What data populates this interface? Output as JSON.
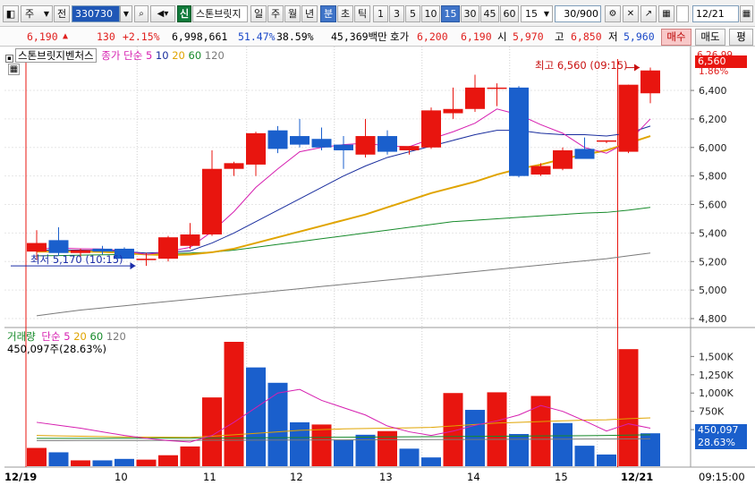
{
  "toolbar": {
    "type_label": "주",
    "prev_label": "전",
    "code": "330730",
    "market_badge": "신",
    "stock_name": "스톤브릿지",
    "periods": [
      "일",
      "주",
      "월",
      "년",
      "분",
      "초",
      "틱"
    ],
    "active_period": "분",
    "intervals": [
      "1",
      "3",
      "5",
      "10",
      "15",
      "30",
      "45",
      "60"
    ],
    "active_interval": "15",
    "interval_select": "15",
    "count_value": "30",
    "count_total": "/900",
    "date_value": "12/21"
  },
  "quote": {
    "price": "6,190",
    "change": "130",
    "change_pct": "+2.15%",
    "volume": "6,998,661",
    "vol_ratio": "51.47%",
    "turnover": "38.59%",
    "amount": "45,369백만",
    "ask_label": "호가",
    "ask_value": "6,200",
    "bid_value": "6,190",
    "open_label": "시",
    "open_value": "5,970",
    "high_label": "고",
    "high_value": "6,850",
    "low_label": "저",
    "low_value": "5,960",
    "buy_label": "매수",
    "sell_label": "매도",
    "extra_label": "평"
  },
  "price_panel": {
    "title": "스톤브릿지벤처스",
    "ma_label": "종가 단순",
    "ma_periods": [
      "5",
      "10",
      "20",
      "60",
      "120"
    ],
    "high_annotation": "최고 6,560 (09:15)",
    "low_annotation": "최저 5,170 (10:15)",
    "top_axis_label": "6,26.99",
    "current_price_tag": "6,560",
    "current_pct_tag": "1.86%"
  },
  "volume_panel": {
    "title": "거래량",
    "ma_label": "단순",
    "ma_periods": [
      "5",
      "20",
      "60",
      "120"
    ],
    "current_value_label": "450,097주(28.63%)",
    "value_tag": "450,097",
    "pct_tag": "28.63%"
  },
  "x_axis": {
    "labels": [
      "12/19",
      "10",
      "11",
      "12",
      "13",
      "14",
      "15",
      "12/21"
    ],
    "time_label": "09:15:00"
  },
  "colors": {
    "up": "#e8150f",
    "down": "#1a5fcc",
    "ma5": "#d61fb0",
    "ma10": "#1a2e9e",
    "ma20": "#e0a400",
    "ma60": "#168a2a",
    "ma120": "#7a7a7a"
  },
  "chart_data": {
    "type": "candlestick",
    "price": {
      "ylim": [
        4750,
        6620
      ],
      "ticks": [
        4800,
        5000,
        5200,
        5400,
        5600,
        5800,
        6000,
        6200,
        6400
      ],
      "tick_labels": [
        "4,800",
        "5,000",
        "5,200",
        "5,400",
        "5,600",
        "5,800",
        "6,000",
        "6,200",
        "6,400"
      ],
      "candles": [
        {
          "o": 5270,
          "h": 5420,
          "l": 5210,
          "c": 5330
        },
        {
          "o": 5350,
          "h": 5440,
          "l": 5240,
          "c": 5260
        },
        {
          "o": 5260,
          "h": 5290,
          "l": 5230,
          "c": 5280
        },
        {
          "o": 5290,
          "h": 5310,
          "l": 5250,
          "c": 5270
        },
        {
          "o": 5290,
          "h": 5300,
          "l": 5220,
          "c": 5220
        },
        {
          "o": 5210,
          "h": 5260,
          "l": 5170,
          "c": 5220
        },
        {
          "o": 5220,
          "h": 5380,
          "l": 5200,
          "c": 5370
        },
        {
          "o": 5310,
          "h": 5470,
          "l": 5290,
          "c": 5390
        },
        {
          "o": 5390,
          "h": 5980,
          "l": 5380,
          "c": 5850
        },
        {
          "o": 5850,
          "h": 5900,
          "l": 5800,
          "c": 5890
        },
        {
          "o": 5880,
          "h": 6110,
          "l": 5800,
          "c": 6100
        },
        {
          "o": 6120,
          "h": 6150,
          "l": 5960,
          "c": 5990
        },
        {
          "o": 6080,
          "h": 6200,
          "l": 6000,
          "c": 6020
        },
        {
          "o": 6060,
          "h": 6140,
          "l": 5980,
          "c": 6000
        },
        {
          "o": 6020,
          "h": 6080,
          "l": 5850,
          "c": 5980
        },
        {
          "o": 5950,
          "h": 6200,
          "l": 5930,
          "c": 6080
        },
        {
          "o": 6080,
          "h": 6120,
          "l": 5950,
          "c": 5970
        },
        {
          "o": 5980,
          "h": 6010,
          "l": 5950,
          "c": 6010
        },
        {
          "o": 6000,
          "h": 6280,
          "l": 5990,
          "c": 6260
        },
        {
          "o": 6240,
          "h": 6420,
          "l": 6200,
          "c": 6270
        },
        {
          "o": 6270,
          "h": 6510,
          "l": 6250,
          "c": 6420
        },
        {
          "o": 6420,
          "h": 6450,
          "l": 6290,
          "c": 6420
        },
        {
          "o": 6420,
          "h": 6430,
          "l": 5790,
          "c": 5800
        },
        {
          "o": 5810,
          "h": 5890,
          "l": 5800,
          "c": 5870
        },
        {
          "o": 5850,
          "h": 6000,
          "l": 5840,
          "c": 5980
        },
        {
          "o": 5990,
          "h": 6070,
          "l": 5920,
          "c": 5920
        },
        {
          "o": 6040,
          "h": 6050,
          "l": 6030,
          "c": 6050
        },
        {
          "o": 5970,
          "h": 6440,
          "l": 5960,
          "c": 6440
        },
        {
          "o": 6380,
          "h": 6560,
          "l": 6310,
          "c": 6540
        }
      ],
      "ma5": [
        5290,
        5295,
        5290,
        5288,
        5275,
        5250,
        5270,
        5300,
        5410,
        5550,
        5720,
        5850,
        5970,
        6000,
        6020,
        6030,
        6010,
        6005,
        6060,
        6110,
        6170,
        6270,
        6230,
        6160,
        6100,
        6000,
        5960,
        6040,
        6200
      ],
      "ma10": [
        5280,
        5280,
        5280,
        5278,
        5270,
        5260,
        5265,
        5275,
        5330,
        5400,
        5480,
        5560,
        5640,
        5720,
        5800,
        5870,
        5930,
        5970,
        6010,
        6050,
        6090,
        6120,
        6120,
        6100,
        6090,
        6090,
        6080,
        6100,
        6150
      ],
      "ma20": [
        5270,
        5270,
        5270,
        5268,
        5260,
        5250,
        5245,
        5250,
        5265,
        5290,
        5330,
        5370,
        5410,
        5450,
        5490,
        5530,
        5580,
        5630,
        5680,
        5720,
        5760,
        5810,
        5850,
        5880,
        5920,
        5950,
        5980,
        6030,
        6080
      ],
      "ma60": [
        5240,
        5242,
        5245,
        5247,
        5250,
        5252,
        5255,
        5260,
        5265,
        5280,
        5300,
        5320,
        5340,
        5360,
        5380,
        5400,
        5420,
        5440,
        5460,
        5480,
        5490,
        5500,
        5510,
        5520,
        5530,
        5540,
        5545,
        5560,
        5580
      ],
      "ma120": [
        4820,
        4840,
        4860,
        4875,
        4890,
        4905,
        4920,
        4935,
        4950,
        4965,
        4980,
        4995,
        5010,
        5025,
        5040,
        5055,
        5070,
        5085,
        5100,
        5115,
        5130,
        5145,
        5160,
        5175,
        5190,
        5205,
        5220,
        5240,
        5260
      ]
    },
    "volume": {
      "ylim": [
        0,
        1700000
      ],
      "ticks": [
        500000,
        750000,
        1000000,
        1250000,
        1500000
      ],
      "tick_labels": [
        "500,000",
        "750K",
        "1,000K",
        "1,250K",
        "1,500K"
      ],
      "values": [
        250000,
        190000,
        80000,
        80000,
        100000,
        90000,
        150000,
        270000,
        940000,
        1700000,
        1350000,
        1140000,
        600000,
        570000,
        360000,
        430000,
        480000,
        240000,
        120000,
        1000000,
        770000,
        1010000,
        440000,
        960000,
        590000,
        280000,
        160000,
        1600000,
        450000
      ],
      "up": [
        true,
        false,
        true,
        false,
        false,
        true,
        true,
        true,
        true,
        true,
        false,
        false,
        false,
        true,
        false,
        false,
        true,
        false,
        false,
        true,
        false,
        true,
        false,
        true,
        false,
        false,
        false,
        true,
        false
      ],
      "ma5": [
        600000,
        560000,
        520000,
        470000,
        420000,
        380000,
        350000,
        330000,
        420000,
        600000,
        800000,
        1000000,
        1050000,
        900000,
        800000,
        700000,
        550000,
        470000,
        420000,
        480000,
        560000,
        620000,
        700000,
        830000,
        750000,
        620000,
        480000,
        580000,
        520000
      ],
      "ma20": [
        420000,
        415000,
        410000,
        405000,
        400000,
        398000,
        396000,
        395000,
        410000,
        430000,
        450000,
        470000,
        490000,
        500000,
        510000,
        515000,
        520000,
        525000,
        530000,
        550000,
        570000,
        590000,
        600000,
        610000,
        620000,
        630000,
        635000,
        650000,
        660000
      ],
      "ma60": [
        380000,
        380000,
        381000,
        381000,
        382000,
        382000,
        383000,
        383000,
        384000,
        386000,
        388000,
        390000,
        392000,
        394000,
        396000,
        398000,
        400000,
        402000,
        404000,
        406000,
        408000,
        410000,
        412000,
        414000,
        416000,
        418000,
        420000,
        425000,
        430000
      ],
      "ma120": [
        350000,
        350000,
        351000,
        351000,
        352000,
        352000,
        353000,
        353000,
        354000,
        355000,
        356000,
        357000,
        358000,
        359000,
        360000,
        361000,
        362000,
        363000,
        364000,
        365000,
        366000,
        367000,
        368000,
        369000,
        370000,
        371000,
        372000,
        373000,
        374000
      ]
    }
  }
}
